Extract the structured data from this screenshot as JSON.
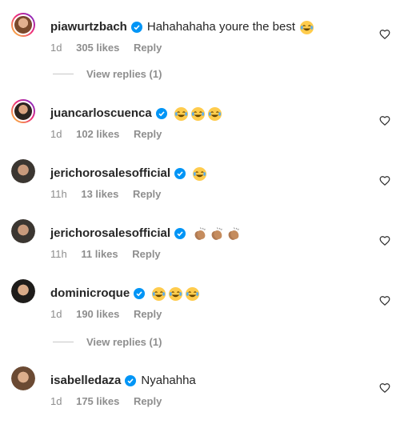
{
  "colors": {
    "verified": "#0095f6",
    "muted": "#8e8e8e",
    "text": "#262626"
  },
  "comments": [
    {
      "username": "piawurtzbach",
      "verified": true,
      "text": "Hahahahaha youre the best",
      "emoji": [
        "laughing-emoji"
      ],
      "time": "1d",
      "likes": "305 likes",
      "reply": "Reply",
      "view_replies": "View replies (1)",
      "story_ring": true
    },
    {
      "username": "juancarloscuenca",
      "verified": true,
      "text": "",
      "emoji": [
        "laughing-emoji",
        "laughing-emoji",
        "laughing-emoji"
      ],
      "time": "1d",
      "likes": "102 likes",
      "reply": "Reply",
      "story_ring": true
    },
    {
      "username": "jerichorosalesofficial",
      "verified": true,
      "text": "",
      "emoji": [
        "laughing-emoji"
      ],
      "time": "11h",
      "likes": "13 likes",
      "reply": "Reply",
      "story_ring": false
    },
    {
      "username": "jerichorosalesofficial",
      "verified": true,
      "text": "",
      "emoji": [
        "clapping-hands-emoji",
        "clapping-hands-emoji",
        "clapping-hands-emoji"
      ],
      "time": "11h",
      "likes": "11 likes",
      "reply": "Reply",
      "story_ring": false
    },
    {
      "username": "dominicroque",
      "verified": true,
      "text": "",
      "emoji": [
        "laughing-emoji",
        "laughing-emoji",
        "laughing-emoji"
      ],
      "time": "1d",
      "likes": "190 likes",
      "reply": "Reply",
      "view_replies": "View replies (1)",
      "story_ring": false
    },
    {
      "username": "isabelledaza",
      "verified": true,
      "text": "Nyahahha",
      "emoji": [],
      "time": "1d",
      "likes": "175 likes",
      "reply": "Reply",
      "story_ring": false
    }
  ]
}
